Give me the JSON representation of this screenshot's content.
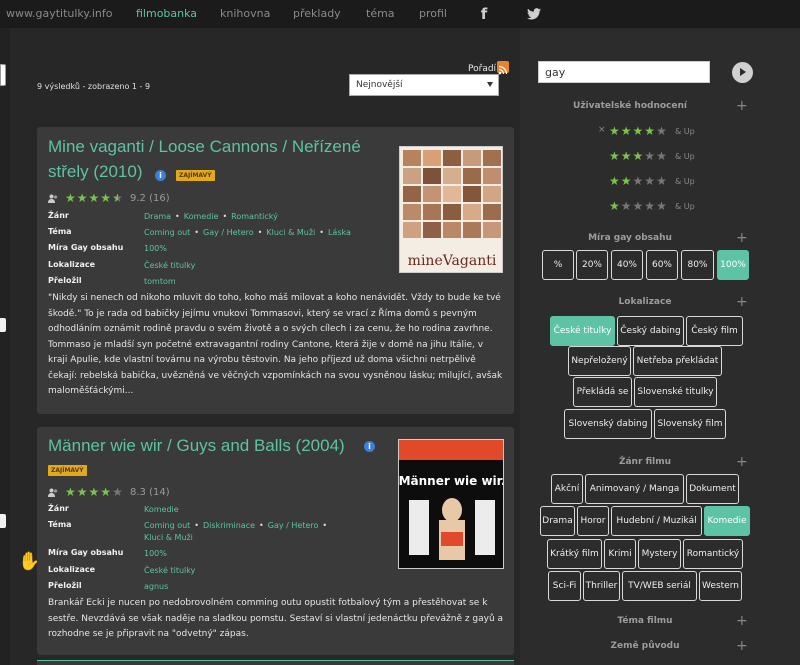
{
  "topbar": {
    "site": "www.gaytitulky.info",
    "nav": [
      "filmobanka",
      "knihovna",
      "překlady",
      "téma",
      "profil"
    ],
    "active": "filmobanka"
  },
  "results": {
    "summary": "9 výsledků - zobrazeno 1 - 9",
    "sort_label": "Pořadí",
    "sort_value": "Nejnovější"
  },
  "films": [
    {
      "title_line1": "Mine vaganti / Loose Cannons / Neřízené",
      "title_line2": "střely (2010)",
      "badge": "ZAJÍMAVÝ",
      "rating": "9.2",
      "votes": "(16)",
      "stars": 4.5,
      "fields": {
        "zanr_label": "Žánr",
        "zanr": [
          "Drama",
          "Komedie",
          "Romantický"
        ],
        "tema_label": "Téma",
        "tema": [
          "Coming out",
          "Gay / Hetero",
          "Kluci & Muži",
          "Láska"
        ],
        "mira_label": "Míra Gay obsahu",
        "mira": "100%",
        "lok_label": "Lokalizace",
        "lok": "České titulky",
        "prel_label": "Přeložil",
        "prel": "tomtom"
      },
      "description": "\"Nikdy si nenech od nikoho mluvit do toho, koho máš milovat a koho nenávidět. Vždy to bude ke tvé škodě.\" To je rada od babičky jejímu vnukovi Tommasovi, který se vrací z Říma domů s pevným odhodláním oznámit rodině pravdu o svém životě a o svých cílech i za cenu, že ho rodina zavrhne. Tommaso je mladší syn početné extravagantní rodiny Cantone, která žije v domě na jihu Itálie, v kraji Apulie, kde vlastní továrnu na výrobu těstovin. Na jeho příjezd už doma všichni netrpělivě čekají: rebelská babička, uvězněná ve věčných vzpomínkách na svou vysněnou lásku; milující, avšak maloměšťáckými...",
      "poster_text": "mineVaganti"
    },
    {
      "title_line1": "Männer wie wir / Guys and Balls (2004)",
      "badge": "ZAJÍMAVÝ",
      "rating": "8.3",
      "votes": "(14)",
      "stars": 4,
      "fields": {
        "zanr_label": "Žánr",
        "zanr": [
          "Komedie"
        ],
        "tema_label": "Téma",
        "tema": [
          "Coming out",
          "Diskriminace",
          "Gay / Hetero"
        ],
        "tema2": [
          "Kluci & Muži"
        ],
        "mira_label": "Míra Gay obsahu",
        "mira": "100%",
        "lok_label": "Lokalizace",
        "lok": "České titulky",
        "prel_label": "Přeložil",
        "prel": "agnus"
      },
      "description": "Brankář Ecki je nucen po nedobrovolném comming outu opustit fotbalový tým a přestěhovat se k sestře. Nevzdává se však naděje na sladkou pomstu. Sestaví si vlastní jedenáctku převážně z gayů a rozhodne se je připravit na \"odvetný\" zápas.",
      "poster_text": "Männer wie wir."
    }
  ],
  "sidebar": {
    "search_value": "gay",
    "user_ratings": {
      "heading": "Uživatelské hodnocení",
      "rows": [
        4,
        3,
        2,
        1
      ],
      "andup": "& Up"
    },
    "gay_content": {
      "heading": "Míra gay obsahu",
      "options": [
        "%",
        "20%",
        "40%",
        "60%",
        "80%",
        "100%"
      ],
      "active": "100%"
    },
    "localization": {
      "heading": "Lokalizace",
      "options": [
        "České titulky",
        "Český dabing",
        "Český film",
        "Nepřeložený",
        "Netřeba překládat",
        "Překládá se",
        "Slovenské titulky",
        "Slovenský dabing",
        "Slovenský film"
      ],
      "active": "České titulky"
    },
    "genre": {
      "heading": "Žánr filmu",
      "options": [
        "Akční",
        "Animovaný / Manga",
        "Dokument",
        "Drama",
        "Horor",
        "Hudební / Muzikál",
        "Komedie",
        "Krátký film",
        "Krimi",
        "Mystery",
        "Romantický",
        "Sci-Fi",
        "Thriller",
        "TV/WEB seriál",
        "Western"
      ],
      "active": "Komedie"
    },
    "theme_heading": "Téma filmu",
    "country_heading": "Země původu"
  },
  "colors": {
    "accent": "#5cc3a5",
    "badge": "#e2a91c",
    "star": "#7cc34d",
    "panel": "#3a3a3a",
    "bg": "#272727"
  }
}
